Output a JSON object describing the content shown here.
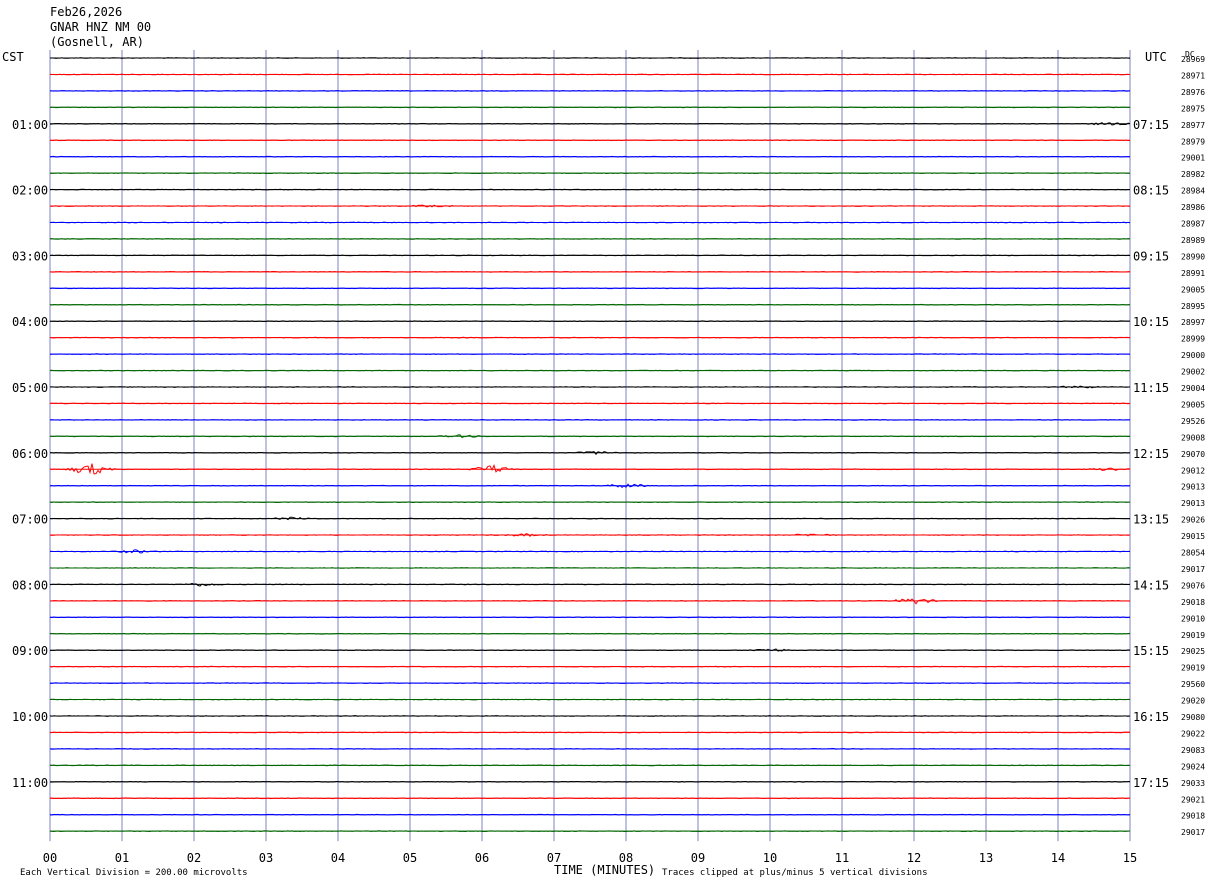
{
  "header": {
    "date": "Feb26,2026",
    "station": "GNAR HNZ NM 00",
    "location": "(Gosnell, AR)"
  },
  "labels": {
    "left_zone": "CST",
    "right_zone": "UTC",
    "dc_header": "DC",
    "x_axis_title": "TIME (MINUTES)",
    "scale_note": "Each Vertical Division =  200.00 microvolts",
    "clip_note": "Traces clipped at plus/minus 5 vertical divisions"
  },
  "colors": {
    "trace_cycle": [
      "#000000",
      "#ff0000",
      "#0000ff",
      "#006600"
    ],
    "grid_vertical": "#8080c0"
  },
  "chart_data": {
    "type": "line",
    "title": "",
    "xlabel": "TIME (MINUTES)",
    "xlim": [
      0,
      15
    ],
    "x_ticks": [
      "00",
      "01",
      "02",
      "03",
      "04",
      "05",
      "06",
      "07",
      "08",
      "09",
      "10",
      "11",
      "12",
      "13",
      "14",
      "15"
    ],
    "trace_count": 48,
    "left_time_labels": [
      "01:00",
      "02:00",
      "03:00",
      "04:00",
      "05:00",
      "06:00",
      "07:00",
      "08:00",
      "09:00",
      "10:00",
      "11:00"
    ],
    "right_time_labels": [
      "07:15",
      "08:15",
      "09:15",
      "10:15",
      "11:15",
      "12:15",
      "13:15",
      "14:15",
      "15:15",
      "16:15",
      "17:15"
    ],
    "dc_values": [
      "28969",
      "28971",
      "28976",
      "28975",
      "28977",
      "28979",
      "29001",
      "28982",
      "28984",
      "28986",
      "28987",
      "28989",
      "28990",
      "28991",
      "29005",
      "28995",
      "28997",
      "28999",
      "29000",
      "29002",
      "29004",
      "29005",
      "29526",
      "29008",
      "29070",
      "29012",
      "29013",
      "29013",
      "29026",
      "29015",
      "28054",
      "29017",
      "29076",
      "29018",
      "29010",
      "29019",
      "29025",
      "29019",
      "29560",
      "29020",
      "29080",
      "29022",
      "29083",
      "29024",
      "29033",
      "29021",
      "29018",
      "29017"
    ],
    "events": [
      {
        "trace": 24,
        "minute": 7.6,
        "amplitude": 1.5
      },
      {
        "trace": 25,
        "minute": 0.55,
        "amplitude": 6
      },
      {
        "trace": 25,
        "minute": 6.15,
        "amplitude": 4
      },
      {
        "trace": 25,
        "minute": 14.7,
        "amplitude": 1.5
      },
      {
        "trace": 26,
        "minute": 8.0,
        "amplitude": 2
      },
      {
        "trace": 28,
        "minute": 3.4,
        "amplitude": 1.5
      },
      {
        "trace": 29,
        "minute": 6.6,
        "amplitude": 1.2
      },
      {
        "trace": 29,
        "minute": 10.6,
        "amplitude": 1.2
      },
      {
        "trace": 30,
        "minute": 1.2,
        "amplitude": 1.5
      },
      {
        "trace": 32,
        "minute": 2.1,
        "amplitude": 1.5
      },
      {
        "trace": 33,
        "minute": 12.0,
        "amplitude": 3
      },
      {
        "trace": 36,
        "minute": 10.0,
        "amplitude": 1.5
      },
      {
        "trace": 20,
        "minute": 14.3,
        "amplitude": 1.0
      },
      {
        "trace": 23,
        "minute": 5.7,
        "amplitude": 1.2
      },
      {
        "trace": 9,
        "minute": 5.3,
        "amplitude": 1.2
      },
      {
        "trace": 4,
        "minute": 14.7,
        "amplitude": 1.2
      }
    ]
  }
}
